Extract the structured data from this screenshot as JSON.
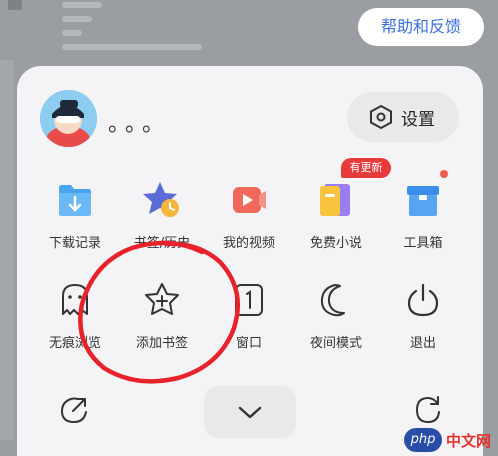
{
  "header": {
    "help_label": "帮助和反馈"
  },
  "profile": {
    "username": "。。。"
  },
  "settings": {
    "label": "设置"
  },
  "grid_row1": [
    {
      "label": "下载记录",
      "icon": "download-folder-icon"
    },
    {
      "label": "书签/历史",
      "icon": "bookmark-star-icon"
    },
    {
      "label": "我的视频",
      "icon": "video-icon"
    },
    {
      "label": "免费小说",
      "icon": "book-icon"
    },
    {
      "label": "工具箱",
      "icon": "toolbox-icon"
    }
  ],
  "grid_row1_badge": "有更新",
  "grid_row2": [
    {
      "label": "无痕浏览",
      "icon": "ghost-icon"
    },
    {
      "label": "添加书签",
      "icon": "add-bookmark-icon"
    },
    {
      "label": "窗口",
      "icon": "window-icon"
    },
    {
      "label": "夜间模式",
      "icon": "moon-icon"
    },
    {
      "label": "退出",
      "icon": "power-icon"
    }
  ],
  "bottom": {
    "share_icon": "share-icon",
    "collapse_icon": "chevron-down-icon",
    "refresh_icon": "refresh-icon"
  },
  "watermark": {
    "logo": "php",
    "text": "中文网"
  },
  "colors": {
    "accent": "#3b6fe0",
    "badge": "#e83a3a",
    "annotation": "#e8222a"
  }
}
